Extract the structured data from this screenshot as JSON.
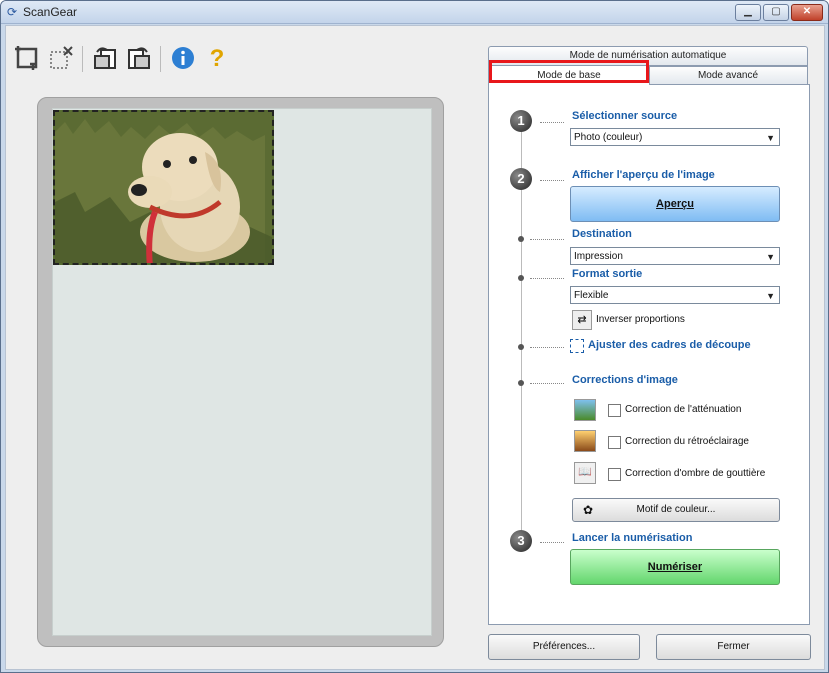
{
  "window": {
    "title": "ScanGear"
  },
  "toolbar": {
    "icons": [
      "crop-icon",
      "clear-crop-icon",
      "rotate-left-icon",
      "rotate-right-icon",
      "info-icon",
      "help-icon"
    ]
  },
  "tabs": {
    "auto": "Mode de numérisation automatique",
    "basic": "Mode de base",
    "advanced": "Mode avancé"
  },
  "panel": {
    "step1": {
      "number": "1",
      "label": "Sélectionner source",
      "value": "Photo (couleur)"
    },
    "step2": {
      "number": "2",
      "label": "Afficher l'aperçu de l'image",
      "button": "Aperçu"
    },
    "destination": {
      "label": "Destination",
      "value": "Impression"
    },
    "output": {
      "label": "Format sortie",
      "value": "Flexible",
      "invert": "Inverser proportions"
    },
    "crop_label": "Ajuster des cadres de découpe",
    "corrections": {
      "label": "Corrections d'image",
      "fade": "Correction de l'atténuation",
      "backlight": "Correction du rétroéclairage",
      "gutter": "Correction d'ombre de gouttière",
      "color_pattern": "Motif de couleur..."
    },
    "step3": {
      "number": "3",
      "label": "Lancer la numérisation",
      "button": "Numériser"
    }
  },
  "footer": {
    "preferences": "Préférences...",
    "close": "Fermer"
  },
  "colors": {
    "highlight": "#e8171b",
    "label_blue": "#1a5da8"
  }
}
